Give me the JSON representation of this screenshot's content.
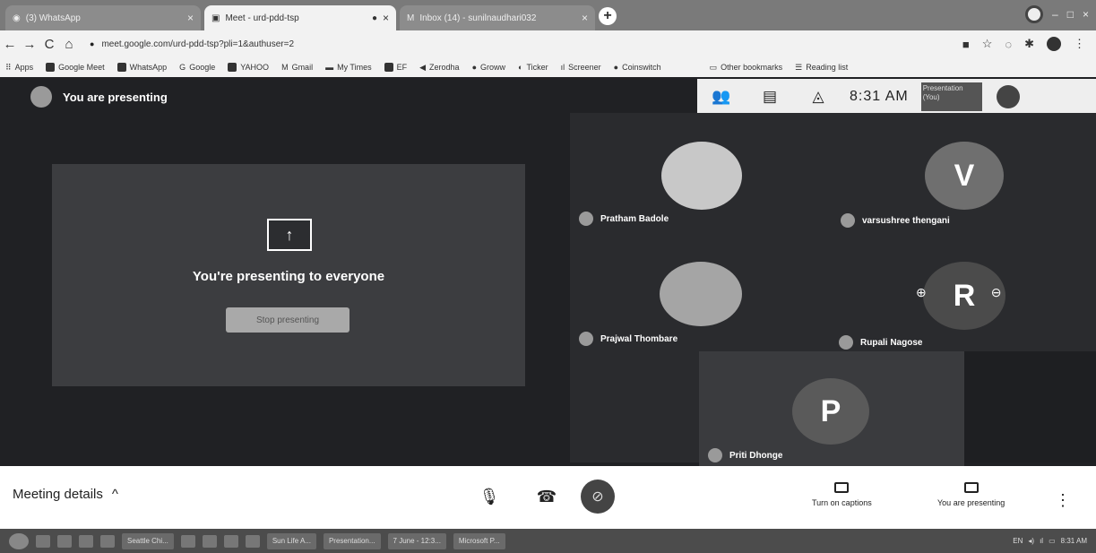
{
  "browser": {
    "tabs": [
      {
        "title": "(3) WhatsApp",
        "close": "×"
      },
      {
        "title": "Meet - urd-pdd-tsp",
        "close": "×"
      },
      {
        "title": "Inbox (14) - sunilnaudhari032",
        "close": "×"
      }
    ],
    "new_tab": "+",
    "nav": {
      "back": "←",
      "forward": "→",
      "reload": "C",
      "home": "⌂"
    },
    "url": "meet.google.com/urd-pdd-tsp?pli=1&authuser=2",
    "window_controls": {
      "minimize": "–",
      "maximize": "□",
      "close": "×"
    }
  },
  "bookmarks": [
    "Apps",
    "Google Meet",
    "WhatsApp",
    "Google",
    "YAHOO",
    "Gmail",
    "My Times",
    "EF",
    "Zerodha",
    "Groww",
    "Ticker",
    "Screener",
    "Coinswitch",
    "Other bookmarks",
    "Reading list"
  ],
  "meet": {
    "banner": "You are presenting",
    "time": "8:31 AM",
    "presentation_thumb": "Presentation (You)",
    "presenting_message": "You're presenting to everyone",
    "stop_button": "Stop presenting",
    "participants": [
      {
        "name": "Pratham Badole",
        "initial": ""
      },
      {
        "name": "varsushree thengani",
        "initial": "V"
      },
      {
        "name": "Prajwal Thombare",
        "initial": ""
      },
      {
        "name": "Rupali Nagose",
        "initial": "R"
      },
      {
        "name": "Priti Dhonge",
        "initial": "P"
      }
    ],
    "pin_icon": "⊕",
    "remove_icon": "⊖"
  },
  "bottom": {
    "meeting_details": "Meeting details",
    "chevron": "^",
    "captions": "Turn on captions",
    "you_presenting": "You are presenting",
    "more": "⋮"
  },
  "taskbar": {
    "items": [
      "Seattle Chi...",
      "Sun Life A...",
      "Presentation...",
      "7 June - 12:3...",
      "Microsoft P..."
    ],
    "tray": "EN",
    "time": "8:31 AM"
  },
  "colors": {
    "meet_bg": "#202124",
    "tile": "#3c3d40",
    "avatar_v": "#6f6f6f",
    "avatar_r": "#4b4b4b",
    "avatar_p": "#5a5a5a"
  }
}
